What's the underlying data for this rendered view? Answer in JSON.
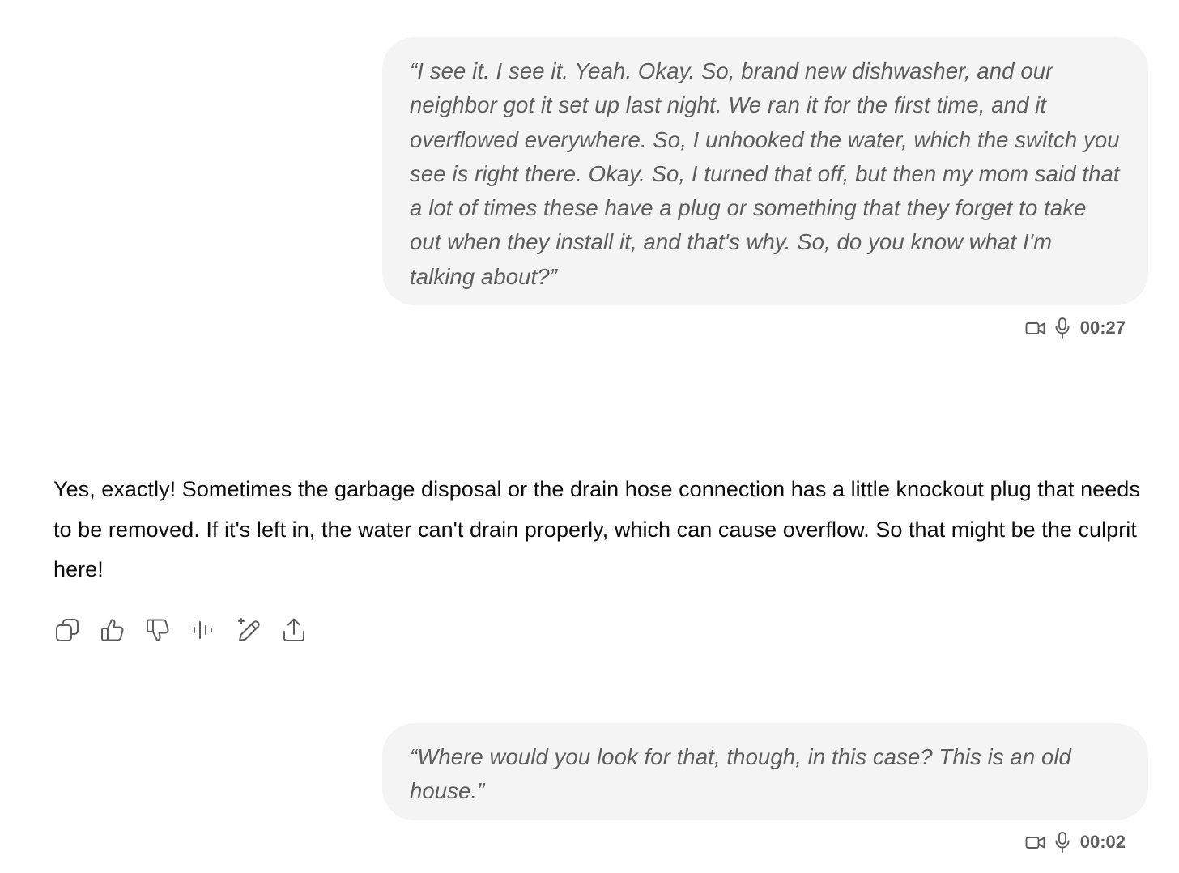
{
  "messages": [
    {
      "role": "user",
      "text": "“I see it. I see it. Yeah. Okay. So, brand new dishwasher, and our neighbor got it set up last night. We ran it for the first time, and it overflowed everywhere. So, I unhooked the water, which the switch you see is right there. Okay. So, I turned that off, but then my mom said that a lot of times these have a plug or something that they forget to take out when they install it, and that's why. So, do you know what I'm talking about?”",
      "duration": "00:27",
      "icons": [
        "video-icon",
        "microphone-icon"
      ]
    },
    {
      "role": "assistant",
      "text": "Yes, exactly! Sometimes the garbage disposal or the drain hose connection has a little knockout plug that needs to be removed. If it's left in, the water can't drain properly, which can cause overflow. So that might be the culprit here!",
      "actions": [
        "copy-icon",
        "thumbs-up-icon",
        "thumbs-down-icon",
        "read-aloud-icon",
        "edit-icon",
        "share-icon"
      ]
    },
    {
      "role": "user",
      "text": "“Where would you look for that, though, in this case? This is an old house.”",
      "duration": "00:02",
      "icons": [
        "video-icon",
        "microphone-icon"
      ]
    }
  ],
  "colors": {
    "user_bubble_bg": "#f4f4f4",
    "user_text": "#5d5d5d",
    "assistant_text": "#0d0d0d",
    "icon": "#5d5d5d"
  }
}
